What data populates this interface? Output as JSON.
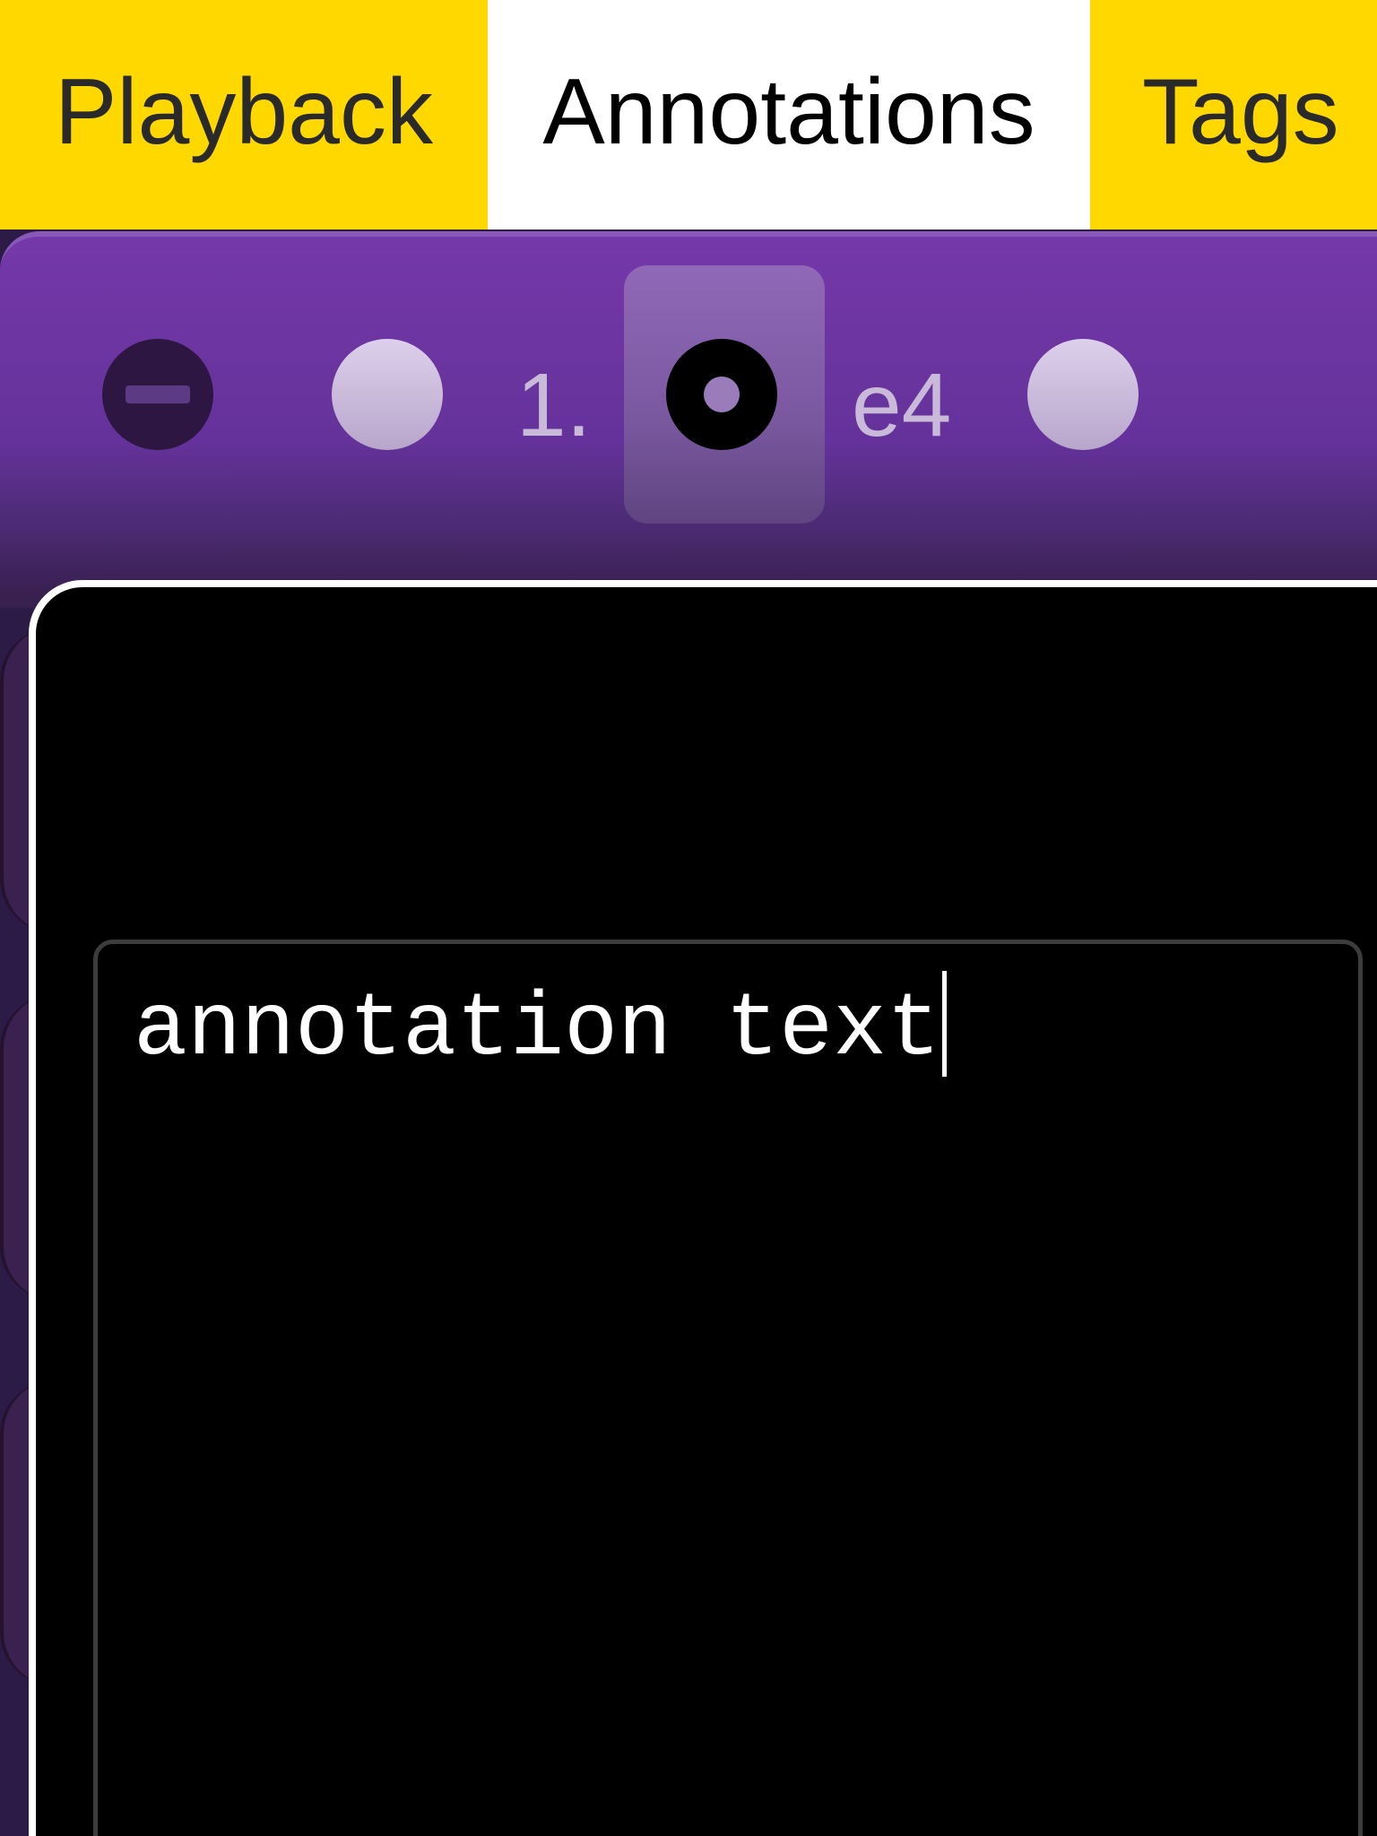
{
  "tabs": [
    {
      "label": "Playback",
      "active": false
    },
    {
      "label": "Annotations",
      "active": true
    },
    {
      "label": "Tags",
      "active": false
    }
  ],
  "toolbar": {
    "move_number": "1.",
    "move_san": "e4",
    "icons": [
      "remove-icon",
      "previous-move-dot",
      "current-move-ring",
      "next-move-dot"
    ]
  },
  "annotation": {
    "text": "annotation text"
  },
  "colors": {
    "tab_yellow": "#ffd800",
    "tab_active": "#ffffff",
    "toolbar_purple": "#64329a",
    "panel_bg": "#000000"
  }
}
